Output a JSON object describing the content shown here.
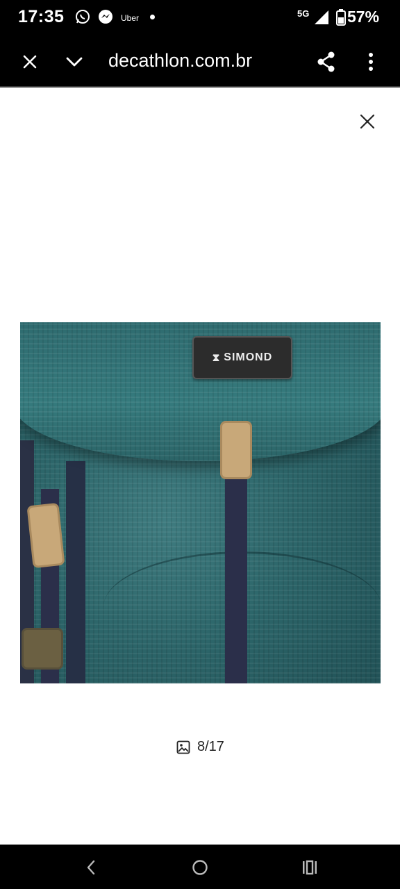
{
  "status_bar": {
    "time": "17:35",
    "notification_icons": [
      "whatsapp-icon",
      "messenger-icon"
    ],
    "uber_label": "Uber",
    "network": "5G",
    "battery": "57%"
  },
  "toolbar": {
    "url": "decathlon.com.br",
    "icons": [
      "close-icon",
      "chevron-down-icon",
      "share-icon",
      "more-vert-icon"
    ]
  },
  "viewer": {
    "photo_brand_label": "SIMOND",
    "counter": "8/17",
    "counter_icon": "image-icon",
    "colors": {
      "fabric": "#2c6569",
      "strap": "#2b2f4a",
      "buckle": "#c8a879"
    }
  },
  "nav_bar": {
    "icons": [
      "back-icon",
      "home-icon",
      "recents-icon"
    ]
  }
}
